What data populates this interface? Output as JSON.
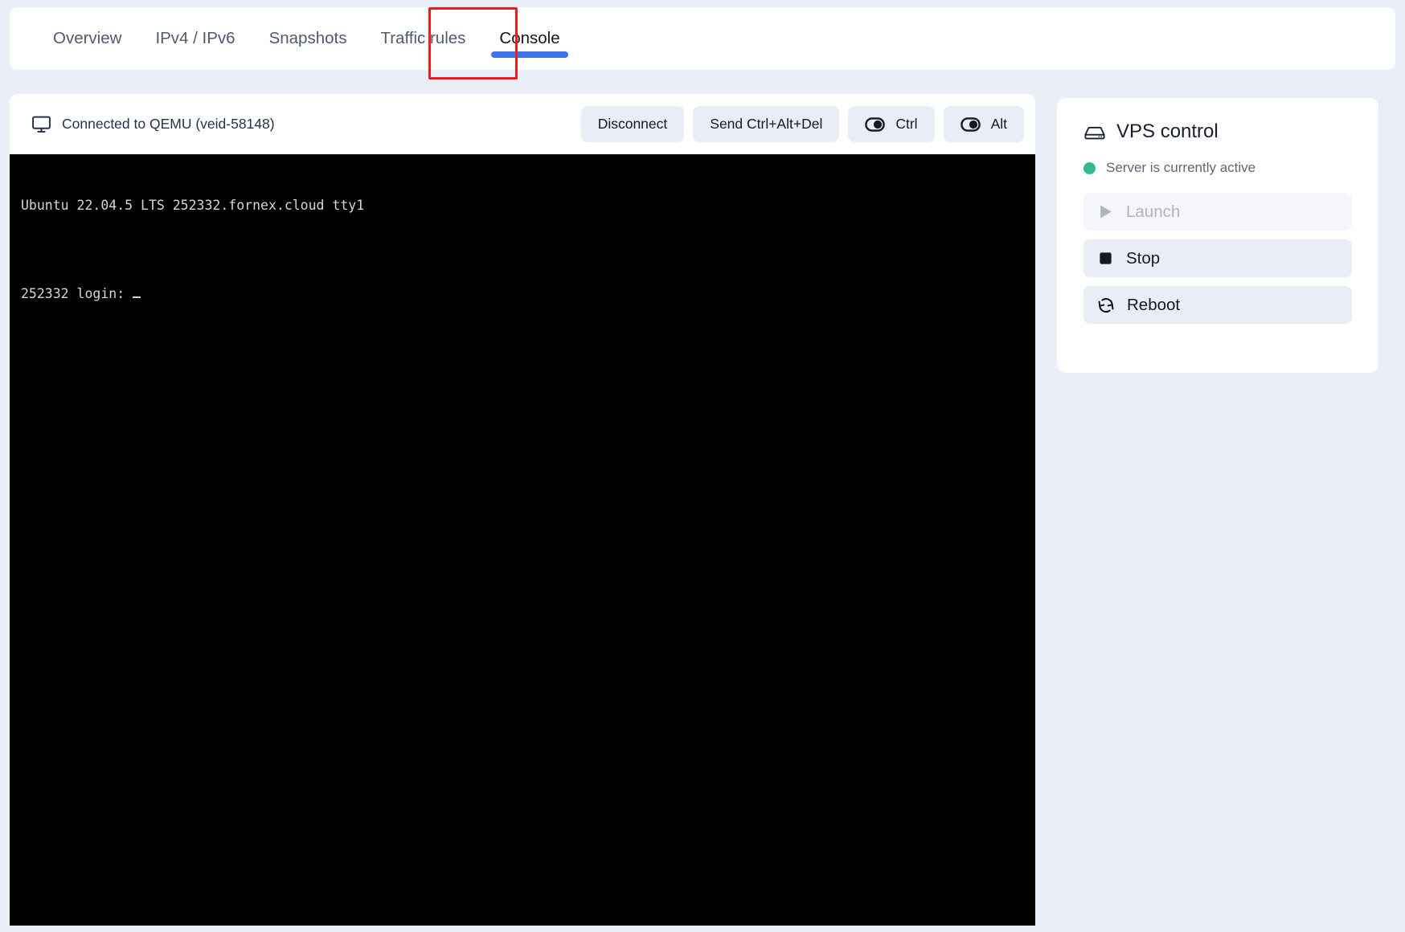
{
  "theme": {
    "page_background": "#eaeef7",
    "card_background": "#ffffff",
    "accent_blue": "#3d74ea",
    "highlight_red": "#f51a1a",
    "status_green": "#34b98a",
    "button_background": "#e9edf6",
    "terminal_background": "#000000"
  },
  "tabs": [
    {
      "label": "Overview",
      "active": false,
      "name": "tab-overview"
    },
    {
      "label": "IPv4 / IPv6",
      "active": false,
      "name": "tab-ipv4-ipv6"
    },
    {
      "label": "Snapshots",
      "active": false,
      "name": "tab-snapshots"
    },
    {
      "label": "Traffic rules",
      "active": false,
      "name": "tab-traffic-rules"
    },
    {
      "label": "Console",
      "active": true,
      "name": "tab-console"
    }
  ],
  "console": {
    "status_text": "Connected to QEMU (veid-58148)",
    "status_icon": "monitor-icon",
    "buttons": [
      {
        "label": "Disconnect",
        "icon": null,
        "name": "disconnect-button"
      },
      {
        "label": "Send Ctrl+Alt+Del",
        "icon": null,
        "name": "send-ctrl-alt-del-button"
      },
      {
        "label": "Ctrl",
        "icon": "toggle-switch-icon",
        "name": "ctrl-toggle-button"
      },
      {
        "label": "Alt",
        "icon": "toggle-switch-icon",
        "name": "alt-toggle-button"
      }
    ],
    "terminal": {
      "line1": "Ubuntu 22.04.5 LTS 252332.fornex.cloud tty1",
      "line2": "252332 login: "
    }
  },
  "vps_control": {
    "title": "VPS control",
    "title_icon": "server-icon",
    "status": "Server is currently active",
    "actions": [
      {
        "label": "Launch",
        "icon": "play-icon",
        "disabled": true,
        "name": "launch-button"
      },
      {
        "label": "Stop",
        "icon": "stop-square-icon",
        "disabled": false,
        "name": "stop-button"
      },
      {
        "label": "Reboot",
        "icon": "refresh-icon",
        "disabled": false,
        "name": "reboot-button"
      }
    ]
  }
}
